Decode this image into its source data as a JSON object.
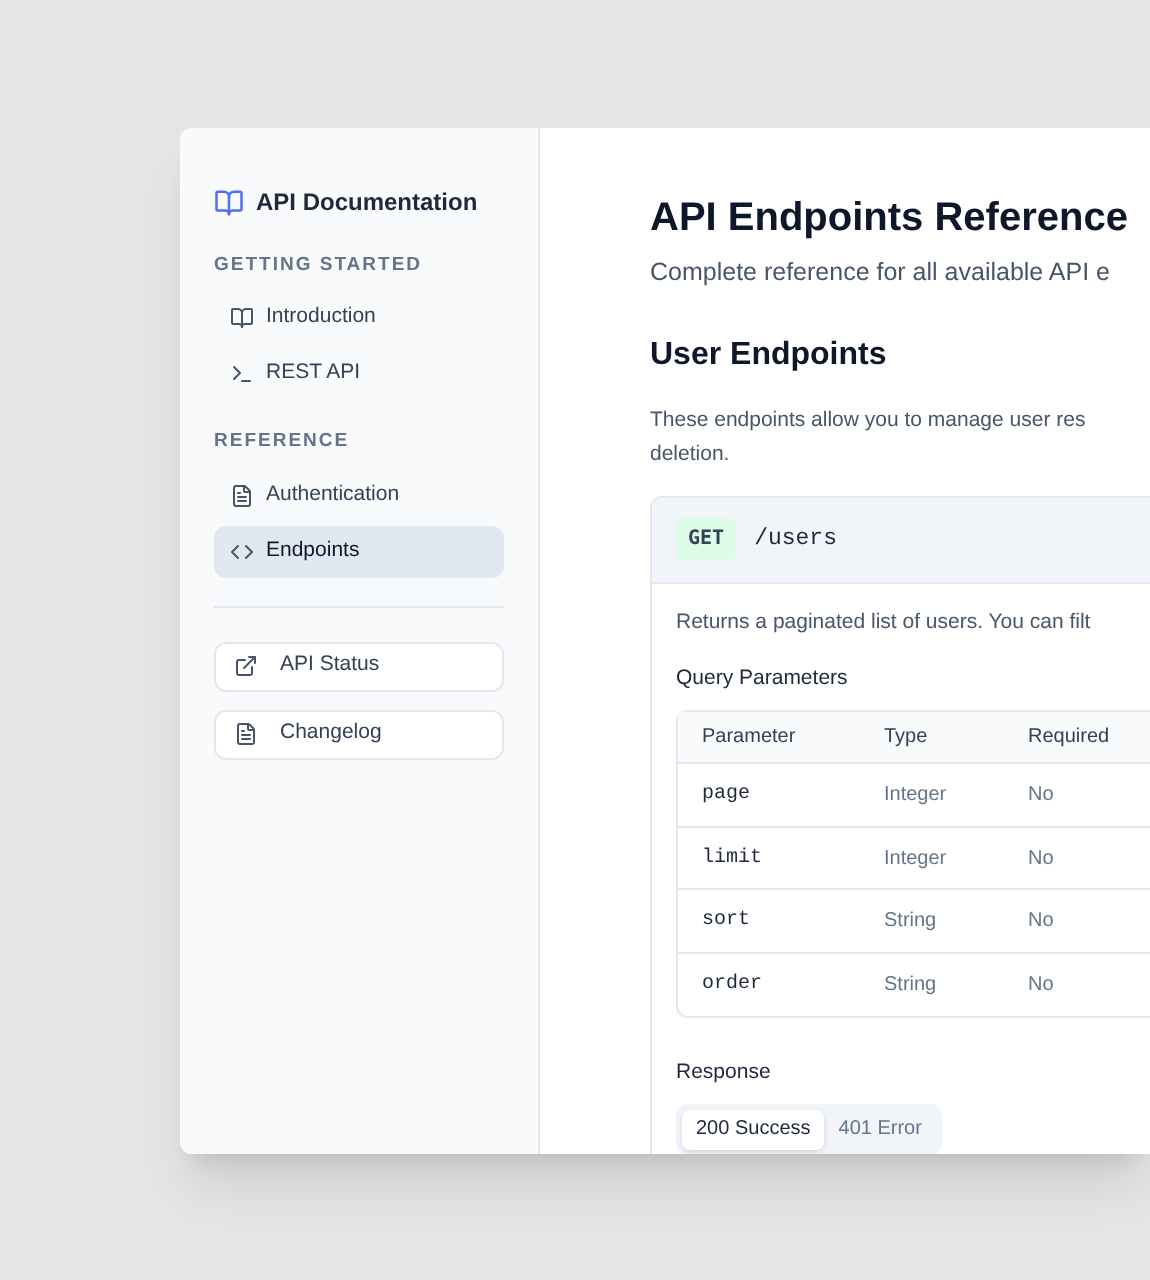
{
  "sidebar": {
    "title": "API Documentation",
    "sections": [
      {
        "heading": "GETTING STARTED",
        "items": [
          {
            "label": "Introduction",
            "kind": "book",
            "selected": false
          },
          {
            "label": "REST API",
            "kind": "terminal",
            "selected": false
          }
        ]
      },
      {
        "heading": "REFERENCE",
        "items": [
          {
            "label": "Authentication",
            "kind": "file",
            "selected": false
          },
          {
            "label": "Endpoints",
            "kind": "code",
            "selected": true
          }
        ]
      }
    ],
    "links": [
      {
        "label": "API Status",
        "kind": "external"
      },
      {
        "label": "Changelog",
        "kind": "file"
      }
    ]
  },
  "main": {
    "title": "API Endpoints Reference",
    "subtitle": "Complete reference for all available API e",
    "section_title": "User Endpoints",
    "section_text": "These endpoints allow you to manage user res\ndeletion.",
    "endpoint": {
      "method": "GET",
      "path": "/users",
      "description": "Returns a paginated list of users. You can filt",
      "params_title": "Query Parameters",
      "table": {
        "columns": [
          "Parameter",
          "Type",
          "Required"
        ],
        "rows": [
          [
            "page",
            "Integer",
            "No"
          ],
          [
            "limit",
            "Integer",
            "No"
          ],
          [
            "sort",
            "String",
            "No"
          ],
          [
            "order",
            "String",
            "No"
          ]
        ]
      },
      "response_title": "Response",
      "response_tabs": [
        {
          "label": "200 Success",
          "selected": true
        },
        {
          "label": "401 Error",
          "selected": false
        }
      ]
    }
  }
}
